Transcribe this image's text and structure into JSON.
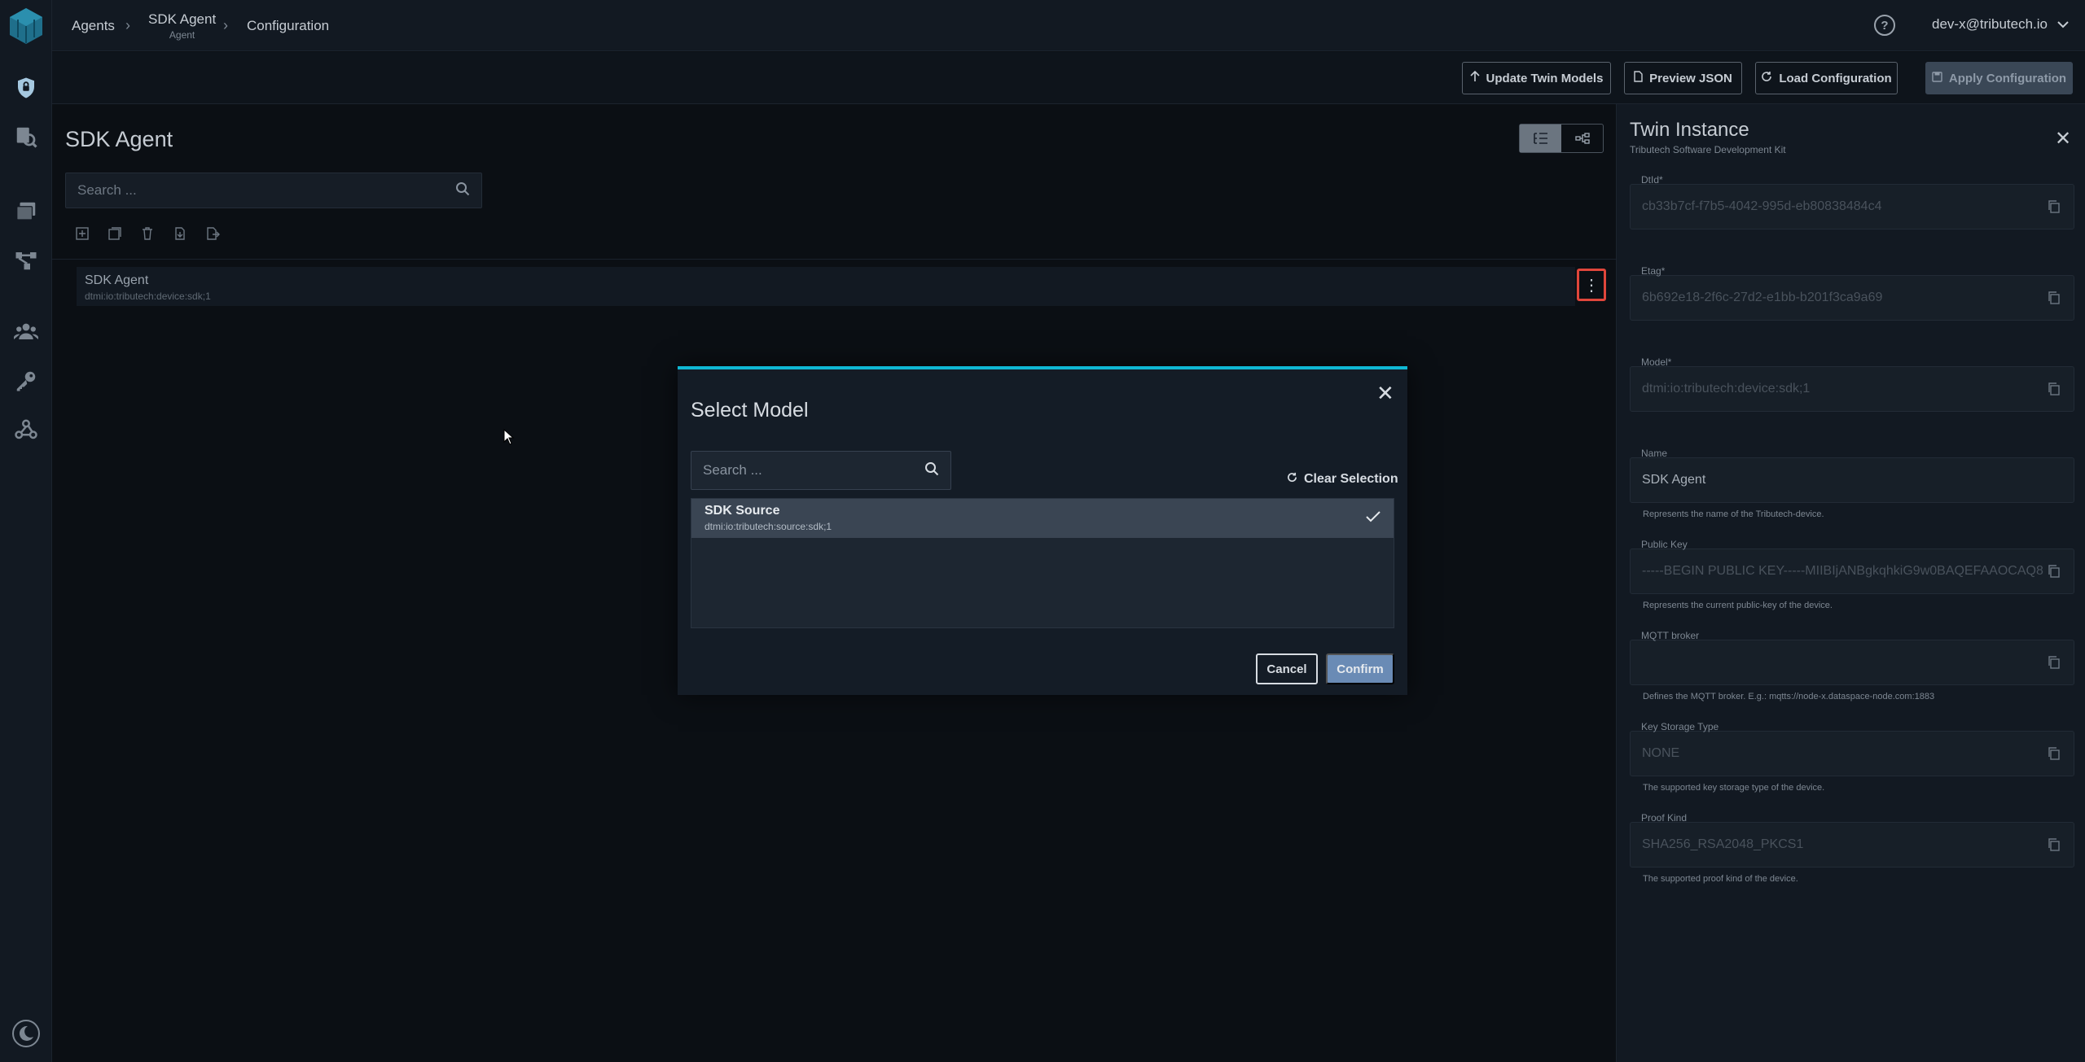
{
  "breadcrumb": {
    "agents": "Agents",
    "agent_name": "SDK Agent",
    "agent_sub": "Agent",
    "configuration": "Configuration"
  },
  "header": {
    "user": "dev-x@tributech.io"
  },
  "toolbar": {
    "update_twin_models": "Update Twin Models",
    "preview_json": "Preview JSON",
    "load_configuration": "Load Configuration",
    "apply_configuration": "Apply Configuration"
  },
  "main": {
    "title": "SDK Agent",
    "search_placeholder": "Search ...",
    "tree_row": {
      "name": "SDK Agent",
      "dtmi": "dtmi:io:tributech:device:sdk;1"
    }
  },
  "panel": {
    "title": "Twin Instance",
    "subtitle": "Tributech Software Development Kit",
    "fields": [
      {
        "label": "DtId*",
        "value": "cb33b7cf-f7b5-4042-995d-eb80838484c4",
        "hint": ""
      },
      {
        "label": "Etag*",
        "value": "6b692e18-2f6c-27d2-e1bb-b201f3ca9a69",
        "hint": ""
      },
      {
        "label": "Model*",
        "value": "dtmi:io:tributech:device:sdk;1",
        "hint": ""
      },
      {
        "label": "Name",
        "value": "SDK Agent",
        "hint": "Represents the name of the Tributech-device."
      },
      {
        "label": "Public Key",
        "value": "-----BEGIN PUBLIC KEY-----MIIBIjANBgkqhkiG9w0BAQEFAAOCAQ8",
        "hint": "Represents the current public-key of the device."
      },
      {
        "label": "MQTT broker",
        "value": "",
        "hint": "Defines the MQTT broker. E.g.: mqtts://node-x.dataspace-node.com:1883"
      },
      {
        "label": "Key Storage Type",
        "value": "NONE",
        "hint": "The supported key storage type of the device."
      },
      {
        "label": "Proof Kind",
        "value": "SHA256_RSA2048_PKCS1",
        "hint": "The supported proof kind of the device."
      }
    ]
  },
  "modal": {
    "title": "Select Model",
    "search_placeholder": "Search ...",
    "clear_selection": "Clear Selection",
    "items": [
      {
        "name": "SDK Source",
        "dtmi": "dtmi:io:tributech:source:sdk;1",
        "selected": true
      }
    ],
    "cancel": "Cancel",
    "confirm": "Confirm"
  },
  "colors": {
    "accent": "#0fb8d4",
    "confirm": "#6a8bb5",
    "highlight": "#e0463b"
  }
}
